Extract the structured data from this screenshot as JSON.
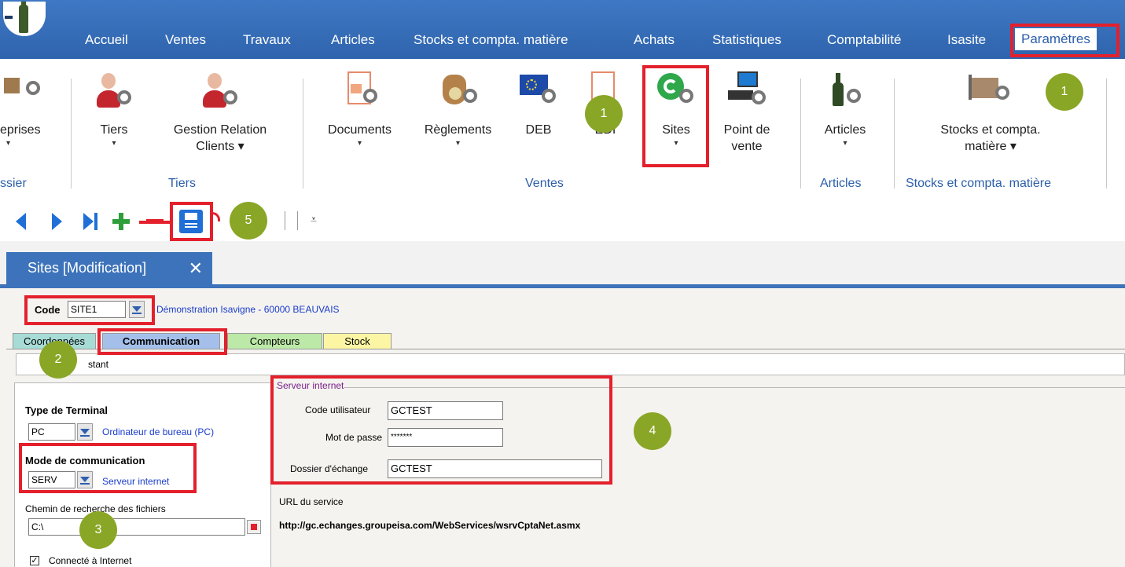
{
  "menu": {
    "items": [
      "Accueil",
      "Ventes",
      "Travaux",
      "Articles",
      "Stocks et compta. matière",
      "Achats",
      "Statistiques",
      "Comptabilité",
      "Isasite"
    ],
    "active": "Paramètres"
  },
  "ribbon": {
    "buttons": [
      {
        "label": "eprises",
        "caret": "▾"
      },
      {
        "label": "Tiers",
        "caret": "▾"
      },
      {
        "label": "Gestion Relation",
        "label2": "Clients ▾"
      },
      {
        "label": "Documents",
        "caret": "▾"
      },
      {
        "label": "Règlements",
        "caret": "▾"
      },
      {
        "label": "DEB"
      },
      {
        "label": "EDI"
      },
      {
        "label": "Sites",
        "caret": "▾"
      },
      {
        "label": "Point de",
        "label2": "vente"
      },
      {
        "label": "Articles",
        "caret": "▾"
      },
      {
        "label": "Stocks et compta.",
        "label2": "matière ▾"
      }
    ],
    "groups": [
      "ssier",
      "Tiers",
      "Ventes",
      "Articles",
      "Stocks et compta. matière"
    ]
  },
  "toolbar": {
    "overflow_glyph": "⩡"
  },
  "doc_tab": {
    "title": "Sites [Modification]",
    "close_glyph": "✕"
  },
  "form": {
    "code_label": "Code",
    "code_value": "SITE1",
    "code_desc": "Démonstration Isavigne - 60000  BEAUVAIS",
    "tabs": [
      "Coordonnées",
      "Communication",
      "Compteurs",
      "Stock"
    ],
    "checkbox_tab_label": "stant",
    "type_terminal_label": "Type de Terminal",
    "type_terminal_value": "PC",
    "type_terminal_desc": "Ordinateur de bureau (PC)",
    "mode_label": "Mode de communication",
    "mode_value": "SERV",
    "mode_desc": "Serveur internet",
    "chemin_label": "Chemin de recherche des fichiers",
    "chemin_value": "C:\\",
    "connecte_label": "Connecté à Internet",
    "server_group_title": "Serveur internet",
    "code_utilisateur_label": "Code utilisateur",
    "code_utilisateur_value": "GCTEST",
    "mot_de_passe_label": "Mot de passe",
    "mot_de_passe_value": "*******",
    "dossier_label": "Dossier d'échange",
    "dossier_value": "GCTEST",
    "url_label": "URL du service",
    "url_value": "http://gc.echanges.groupeisa.com/WebServices/wsrvCptaNet.asmx"
  },
  "callouts": [
    "1",
    "1",
    "2",
    "3",
    "4",
    "5"
  ],
  "colors": {
    "menu_blue": "#3469b3",
    "callout_red": "#e3202b",
    "bubble_green": "#8aa626"
  }
}
